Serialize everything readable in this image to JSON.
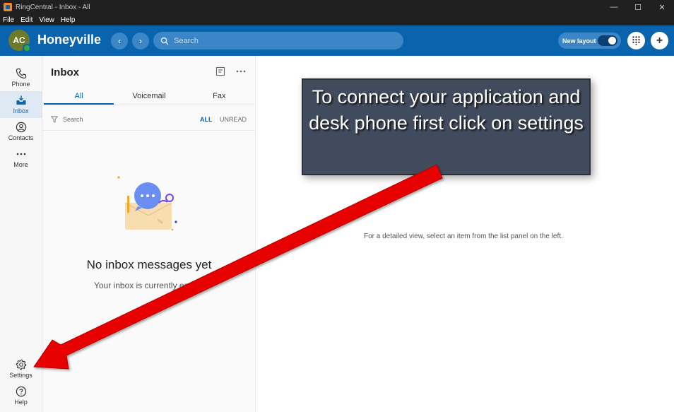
{
  "window": {
    "title": "RingCentral - Inbox - All",
    "controls": {
      "minimize": "—",
      "maximize": "☐",
      "close": "✕"
    }
  },
  "menu": {
    "items": [
      "File",
      "Edit",
      "View",
      "Help"
    ]
  },
  "header": {
    "avatar_initials": "AC",
    "company": "Honeyville",
    "back_glyph": "‹",
    "forward_glyph": "›",
    "search_placeholder": "Search",
    "new_layout_label": "New layout",
    "add_glyph": "+"
  },
  "rail": {
    "items": [
      {
        "label": "Phone",
        "icon": "phone-icon"
      },
      {
        "label": "Inbox",
        "icon": "inbox-icon",
        "active": true
      },
      {
        "label": "Contacts",
        "icon": "contacts-icon"
      },
      {
        "label": "More",
        "icon": "more-icon"
      }
    ],
    "settings_label": "Settings",
    "help_label": "Help"
  },
  "inbox": {
    "title": "Inbox",
    "tabs": [
      {
        "label": "All",
        "active": true
      },
      {
        "label": "Voicemail"
      },
      {
        "label": "Fax"
      }
    ],
    "search_label": "Search",
    "filter_all": "ALL",
    "filter_unread": "UNREAD",
    "empty_title": "No inbox messages yet",
    "empty_subtitle": "Your inbox is currently empty."
  },
  "main": {
    "hint": "For a detailed view, select an item from the list panel on the left."
  },
  "callout": {
    "text": "To connect your application and desk phone first click on settings"
  },
  "colors": {
    "brand": "#0a64ad",
    "arrow": "#e60000",
    "callout_bg": "#414b5e"
  }
}
